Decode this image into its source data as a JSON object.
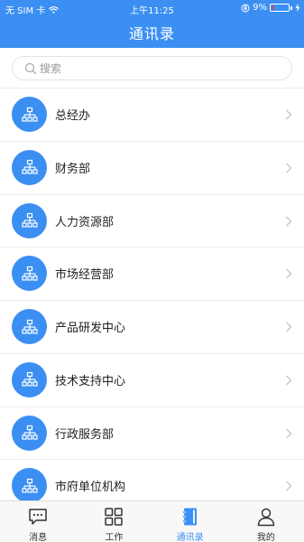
{
  "status_bar": {
    "carrier": "无 SIM 卡",
    "time": "上午11:25",
    "battery_percent": "9%",
    "battery_level": 0.09
  },
  "header": {
    "title": "通讯录"
  },
  "search": {
    "placeholder": "搜索",
    "value": ""
  },
  "departments": [
    {
      "label": "总经办"
    },
    {
      "label": "财务部"
    },
    {
      "label": "人力资源部"
    },
    {
      "label": "市场经营部"
    },
    {
      "label": "产品研发中心"
    },
    {
      "label": "技术支持中心"
    },
    {
      "label": "行政服务部"
    },
    {
      "label": "市府单位机构"
    }
  ],
  "tabbar": {
    "tabs": [
      {
        "label": "消息",
        "icon": "message-icon"
      },
      {
        "label": "工作",
        "icon": "grid-icon"
      },
      {
        "label": "通讯录",
        "icon": "contacts-book-icon"
      },
      {
        "label": "我的",
        "icon": "person-icon"
      }
    ],
    "active_index": 2
  },
  "colors": {
    "accent": "#3b8ff2",
    "battery_low": "#ff3b30"
  }
}
